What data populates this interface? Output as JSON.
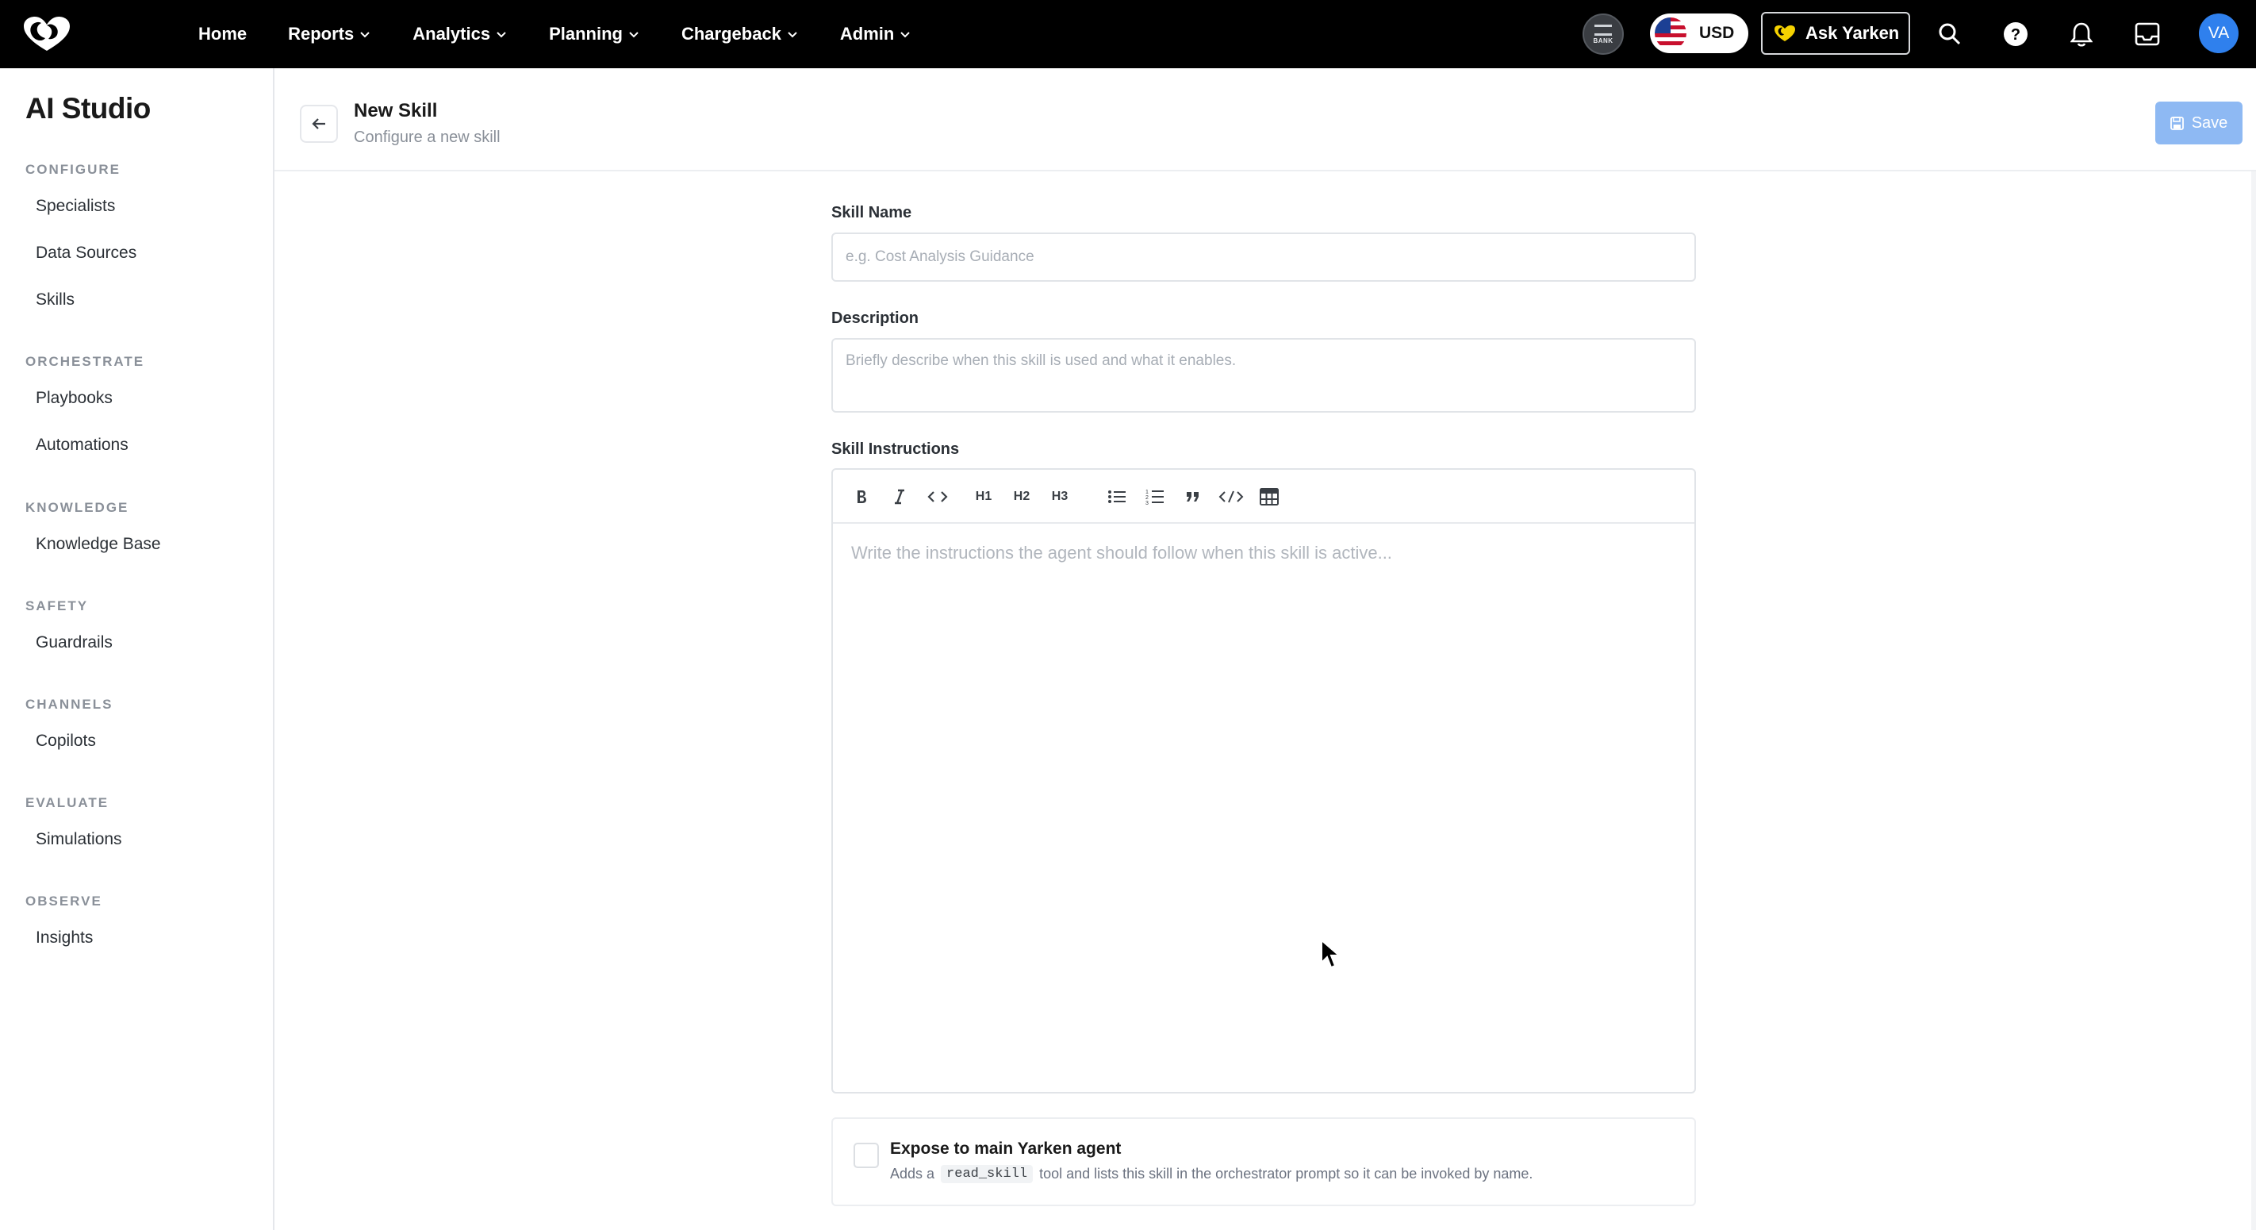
{
  "topnav": {
    "links": [
      {
        "label": "Home",
        "dropdown": false
      },
      {
        "label": "Reports",
        "dropdown": true
      },
      {
        "label": "Analytics",
        "dropdown": true
      },
      {
        "label": "Planning",
        "dropdown": true
      },
      {
        "label": "Chargeback",
        "dropdown": true
      },
      {
        "label": "Admin",
        "dropdown": true
      }
    ],
    "bank_label": "BANK",
    "currency": "USD",
    "ask_label": "Ask Yarken",
    "avatar_initials": "VA",
    "icons": [
      "search-icon",
      "help-icon",
      "bell-icon",
      "inbox-icon"
    ]
  },
  "sidebar": {
    "title": "AI Studio",
    "sections": [
      {
        "heading": "CONFIGURE",
        "items": [
          "Specialists",
          "Data Sources",
          "Skills"
        ]
      },
      {
        "heading": "ORCHESTRATE",
        "items": [
          "Playbooks",
          "Automations"
        ]
      },
      {
        "heading": "KNOWLEDGE",
        "items": [
          "Knowledge Base"
        ]
      },
      {
        "heading": "SAFETY",
        "items": [
          "Guardrails"
        ]
      },
      {
        "heading": "CHANNELS",
        "items": [
          "Copilots"
        ]
      },
      {
        "heading": "EVALUATE",
        "items": [
          "Simulations"
        ]
      },
      {
        "heading": "OBSERVE",
        "items": [
          "Insights"
        ]
      }
    ]
  },
  "header": {
    "title": "New Skill",
    "subtitle": "Configure a new skill",
    "save_label": "Save"
  },
  "form": {
    "skill_name": {
      "label": "Skill Name",
      "value": "",
      "placeholder": "e.g. Cost Analysis Guidance"
    },
    "description": {
      "label": "Description",
      "value": "",
      "placeholder": "Briefly describe when this skill is used and what it enables."
    },
    "instructions": {
      "label": "Skill Instructions",
      "placeholder": "Write the instructions the agent should follow when this skill is active...",
      "toolbar": [
        "bold-icon",
        "italic-icon",
        "inline-code-icon",
        "H1",
        "H2",
        "H3",
        "bullet-list-icon",
        "numbered-list-icon",
        "blockquote-icon",
        "code-block-icon",
        "table-icon"
      ]
    },
    "expose": {
      "checked": false,
      "title": "Expose to main Yarken agent",
      "desc_before": "Adds a",
      "code": "read_skill",
      "desc_after": "tool and lists this skill in the orchestrator prompt so it can be invoked by name."
    }
  },
  "colors": {
    "nav_bg": "#000000",
    "accent": "#2f80ed",
    "save_disabled": "#8eb9f3"
  }
}
